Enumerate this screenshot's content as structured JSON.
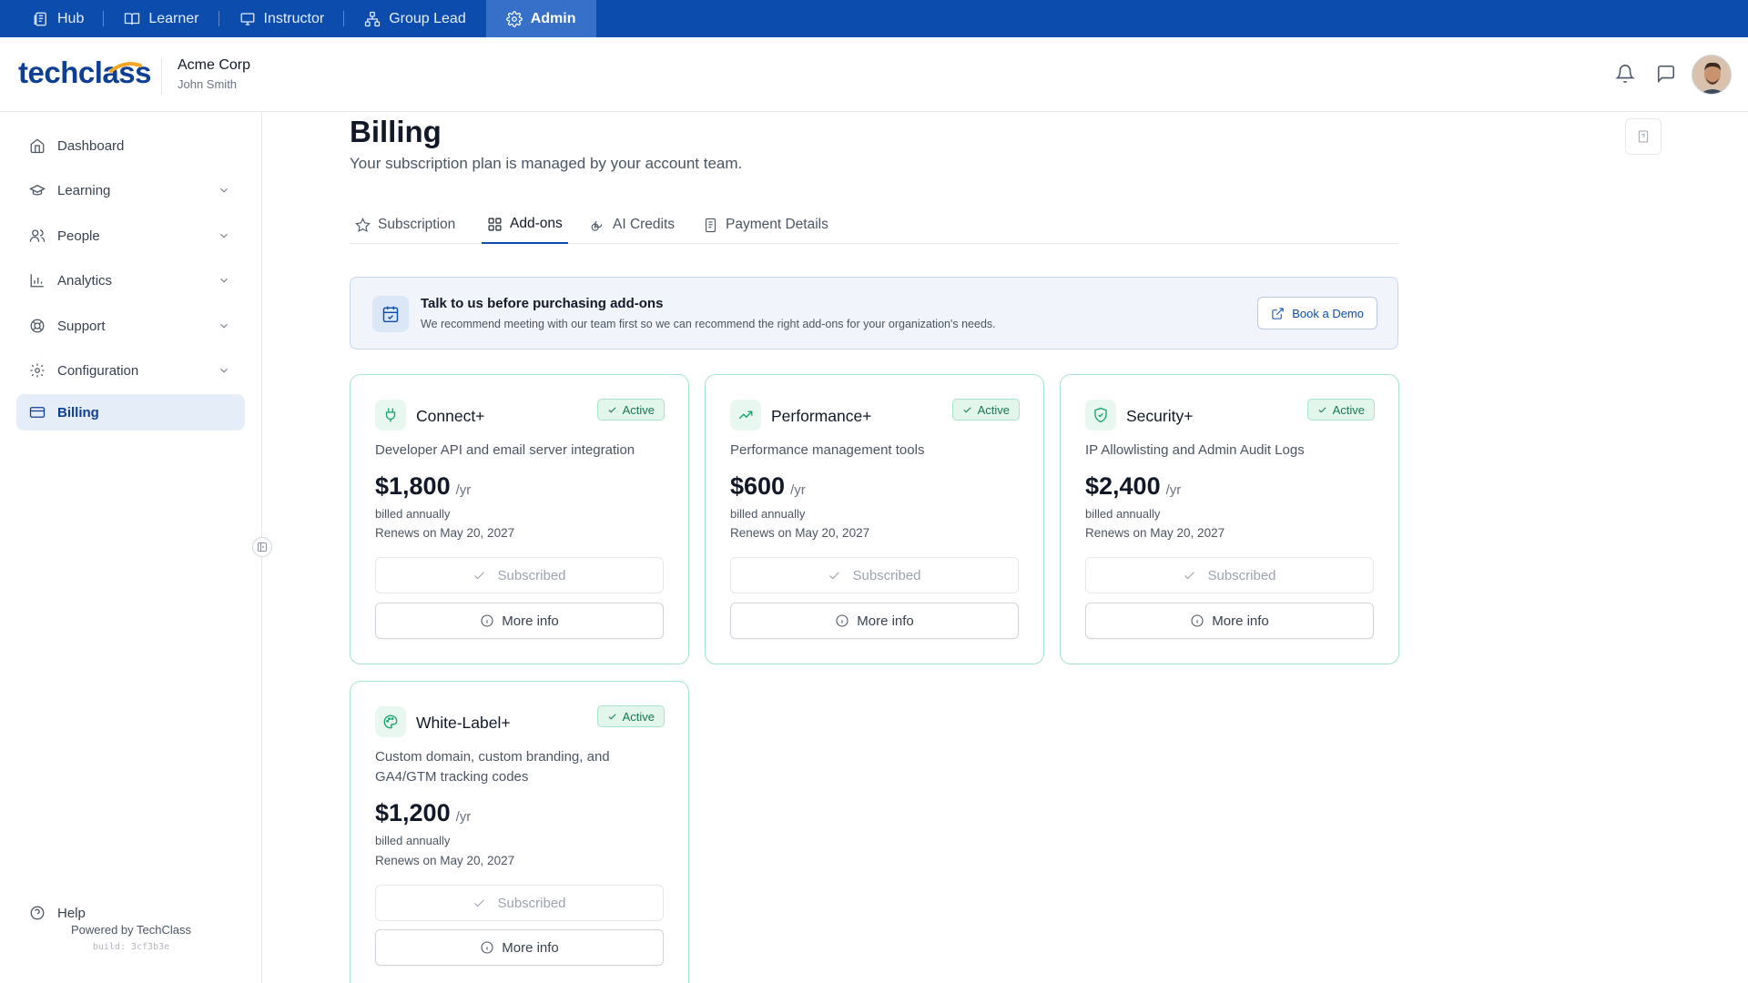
{
  "topnav": {
    "items": [
      {
        "label": "Hub",
        "icon": "hub-icon"
      },
      {
        "label": "Learner",
        "icon": "book-icon"
      },
      {
        "label": "Instructor",
        "icon": "presentation-icon"
      },
      {
        "label": "Group Lead",
        "icon": "org-chart-icon"
      },
      {
        "label": "Admin",
        "icon": "gear-icon",
        "active": true
      }
    ]
  },
  "header": {
    "logo": "techclass",
    "org_name": "Acme Corp",
    "user_name": "John Smith"
  },
  "sidebar": {
    "items": [
      {
        "label": "Dashboard",
        "icon": "home-icon"
      },
      {
        "label": "Learning",
        "icon": "graduation-cap-icon"
      },
      {
        "label": "People",
        "icon": "users-icon"
      },
      {
        "label": "Analytics",
        "icon": "bar-chart-icon"
      },
      {
        "label": "Support",
        "icon": "lifebuoy-icon"
      },
      {
        "label": "Configuration",
        "icon": "gear-icon"
      },
      {
        "label": "Billing",
        "icon": "credit-card-icon",
        "active": true
      }
    ],
    "help_label": "Help",
    "powered_by": "Powered by TechClass",
    "build": "build: 3cf3b3e"
  },
  "page": {
    "title": "Billing",
    "subtitle": "Your subscription plan is managed by your account team."
  },
  "tabs": [
    {
      "label": "Subscription",
      "icon": "star-icon"
    },
    {
      "label": "Add-ons",
      "icon": "grid-icon",
      "active": true
    },
    {
      "label": "AI Credits",
      "icon": "coins-icon"
    },
    {
      "label": "Payment Details",
      "icon": "receipt-icon"
    }
  ],
  "banner": {
    "title": "Talk to us before purchasing add-ons",
    "text": "We recommend meeting with our team first so we can recommend the right add-ons for your organization's needs.",
    "button": "Book a Demo"
  },
  "addons": [
    {
      "name": "Connect+",
      "icon": "plug-icon",
      "badge": "Active",
      "description": "Developer API and email server integration",
      "price": "$1,800",
      "period": "/yr",
      "billed": "billed annually",
      "renews": "Renews on May 20, 2027",
      "subscribed_label": "Subscribed",
      "more_label": "More info"
    },
    {
      "name": "Performance+",
      "icon": "trending-up-icon",
      "badge": "Active",
      "description": "Performance management tools",
      "price": "$600",
      "period": "/yr",
      "billed": "billed annually",
      "renews": "Renews on May 20, 2027",
      "subscribed_label": "Subscribed",
      "more_label": "More info"
    },
    {
      "name": "Security+",
      "icon": "shield-check-icon",
      "badge": "Active",
      "description": "IP Allowlisting and Admin Audit Logs",
      "price": "$2,400",
      "period": "/yr",
      "billed": "billed annually",
      "renews": "Renews on May 20, 2027",
      "subscribed_label": "Subscribed",
      "more_label": "More info"
    },
    {
      "name": "White-Label+",
      "icon": "palette-icon",
      "badge": "Active",
      "description": "Custom domain, custom branding, and GA4/GTM tracking codes",
      "price": "$1,200",
      "period": "/yr",
      "billed": "billed annually",
      "renews": "Renews on May 20, 2027",
      "subscribed_label": "Subscribed",
      "more_label": "More info"
    }
  ],
  "colors": {
    "brand_blue": "#0b4cad",
    "active_green": "#16a36f",
    "card_border": "#a7e3cf"
  }
}
